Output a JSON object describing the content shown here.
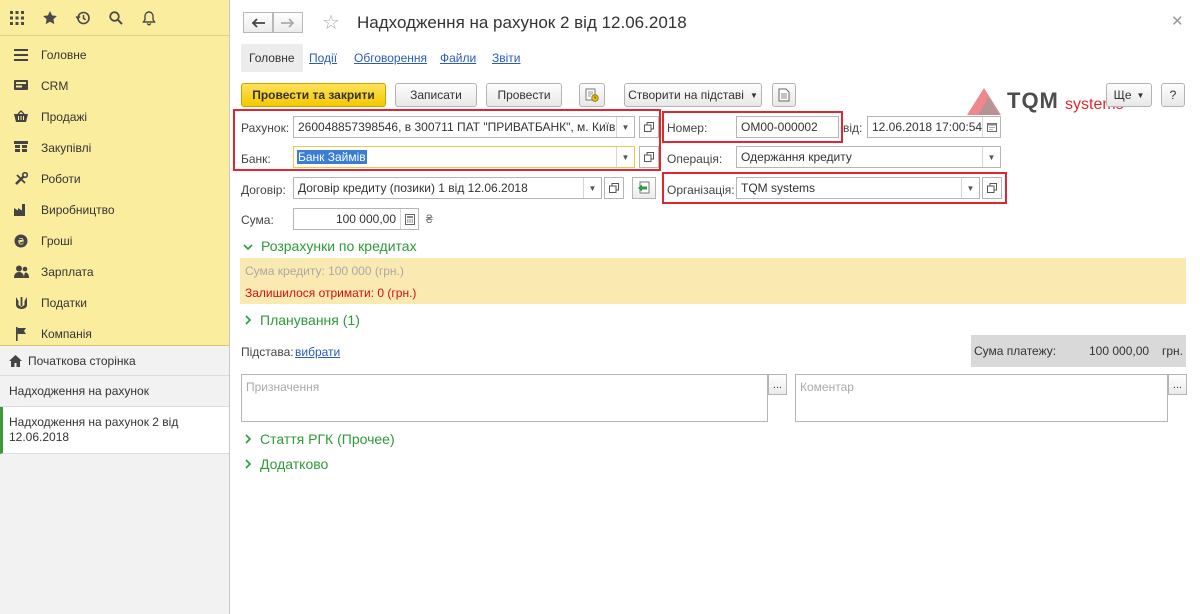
{
  "sidebar": {
    "sections": [
      {
        "label": "Головне",
        "icon": "menu-lines-icon"
      },
      {
        "label": "CRM",
        "icon": "crm-icon"
      },
      {
        "label": "Продажі",
        "icon": "basket-icon"
      },
      {
        "label": "Закупівлі",
        "icon": "cart-icon"
      },
      {
        "label": "Роботи",
        "icon": "tools-icon"
      },
      {
        "label": "Виробництво",
        "icon": "factory-icon"
      },
      {
        "label": "Гроші",
        "icon": "money-icon"
      },
      {
        "label": "Зарплата",
        "icon": "people-icon"
      },
      {
        "label": "Податки",
        "icon": "trident-icon"
      },
      {
        "label": "Компанія",
        "icon": "flag-icon"
      }
    ],
    "open": {
      "home": "Початкова сторінка",
      "list": "Надходження на рахунок",
      "current": "Надходження на рахунок 2 від 12.06.2018"
    }
  },
  "header": {
    "title": "Надходження на рахунок 2 від 12.06.2018"
  },
  "tabs": [
    "Головне",
    "Події",
    "Обговорення",
    "Файли",
    "Звіти"
  ],
  "toolbar": {
    "post_close": "Провести та закрити",
    "save": "Записати",
    "post": "Провести",
    "create_based": "Створити на підставі",
    "more": "Ще",
    "help": "?"
  },
  "logo": {
    "brand": "TQM",
    "suffix": "systems"
  },
  "form": {
    "account_label": "Рахунок:",
    "account_value": "260048857398546, в 300711 ПАТ \"ПРИВАТБАНК\", м. Київ",
    "bank_label": "Банк:",
    "bank_value": "Банк Займів",
    "contract_label": "Договір:",
    "contract_value": "Договір кредиту (позики) 1 від 12.06.2018",
    "sum_label": "Сума:",
    "sum_value": "100 000,00",
    "currency_sign": "₴",
    "number_label": "Номер:",
    "number_value": "ОМ00-000002",
    "date_label": "від:",
    "date_value": "12.06.2018 17:00:54",
    "operation_label": "Операція:",
    "operation_value": "Одержання кредиту",
    "org_label": "Організація:",
    "org_value": "TQM systems"
  },
  "groups": {
    "credit": "Розрахунки по кредитах",
    "planning": "Планування (1)",
    "rgk": "Стаття РГК (Прочее)",
    "extra": "Додатково"
  },
  "credit": {
    "sum_line": "Сума кредиту: 100 000 (грн.)",
    "remaining": "Залишилося отримати: 0 (грн.)"
  },
  "basis": {
    "label": "Підстава:",
    "link": "вибрати"
  },
  "payment": {
    "label": "Сума платежу:",
    "value": "100 000,00",
    "currency": "грн."
  },
  "purpose_placeholder": "Призначення",
  "comment_placeholder": "Коментар",
  "colors": {
    "accent_yellow": "#fbed9e",
    "primary_button": "#f5c800",
    "green_group": "#2f9a3a",
    "highlight_red": "#e0262e",
    "credit_band": "#fbe9b2",
    "warning_red": "#d01010"
  }
}
